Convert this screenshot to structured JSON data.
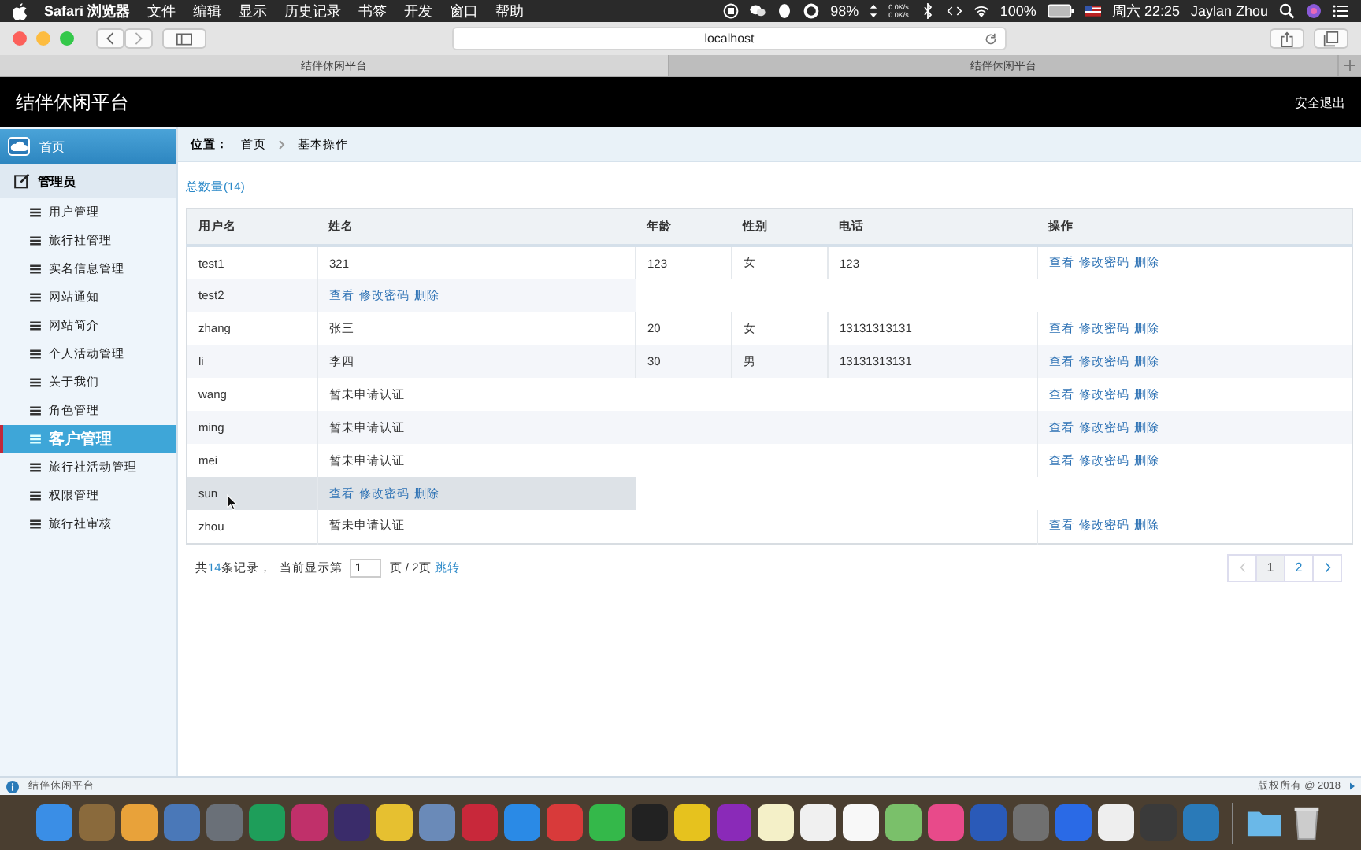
{
  "menubar": {
    "app": "Safari 浏览器",
    "menus": [
      "文件",
      "编辑",
      "显示",
      "历史记录",
      "书签",
      "开发",
      "窗口",
      "帮助"
    ],
    "cpu": "98%",
    "net_up": "0.0K/s",
    "net_down": "0.0K/s",
    "battery": "100%",
    "clock": "周六 22:25",
    "user": "Jaylan Zhou"
  },
  "browser": {
    "address": "localhost",
    "tabs": [
      {
        "title": "结伴休闲平台",
        "selected": true
      },
      {
        "title": "结伴休闲平台",
        "selected": false
      }
    ]
  },
  "header": {
    "title": "结伴休闲平台",
    "logout": "安全退出"
  },
  "sidebar": {
    "home": "首页",
    "section": "管理员",
    "items": [
      {
        "label": "用户管理",
        "selected": false
      },
      {
        "label": "旅行社管理",
        "selected": false
      },
      {
        "label": "实名信息管理",
        "selected": false
      },
      {
        "label": "网站通知",
        "selected": false
      },
      {
        "label": "网站简介",
        "selected": false
      },
      {
        "label": "个人活动管理",
        "selected": false
      },
      {
        "label": "关于我们",
        "selected": false
      },
      {
        "label": "角色管理",
        "selected": false
      },
      {
        "label": "客户管理",
        "selected": true
      },
      {
        "label": "旅行社活动管理",
        "selected": false
      },
      {
        "label": "权限管理",
        "selected": false
      },
      {
        "label": "旅行社审核",
        "selected": false
      }
    ]
  },
  "breadcrumb": {
    "label": "位置：",
    "items": [
      "首页",
      "基本操作"
    ]
  },
  "total": "总数量(14)",
  "table": {
    "columns": [
      "用户名",
      "姓名",
      "年龄",
      "性别",
      "电话",
      "操作"
    ],
    "rows": [
      {
        "kind": "full",
        "username": "test1",
        "name": "321",
        "age": "123",
        "gender": "女",
        "phone": "123",
        "actions": [
          "查看",
          "修改密码",
          "删除"
        ],
        "highlighted": false
      },
      {
        "kind": "short",
        "username": "test2",
        "actions": [
          "查看",
          "修改密码",
          "删除"
        ],
        "highlighted": false
      },
      {
        "kind": "full",
        "username": "zhang",
        "name": "张三",
        "age": "20",
        "gender": "女",
        "phone": "13131313131",
        "actions": [
          "查看",
          "修改密码",
          "删除"
        ],
        "highlighted": false
      },
      {
        "kind": "full",
        "username": "li",
        "name": "李四",
        "age": "30",
        "gender": "男",
        "phone": "13131313131",
        "actions": [
          "查看",
          "修改密码",
          "删除"
        ],
        "highlighted": false
      },
      {
        "kind": "pending",
        "username": "wang",
        "note": "暂未申请认证",
        "actions": [
          "查看",
          "修改密码",
          "删除"
        ],
        "highlighted": false
      },
      {
        "kind": "pending",
        "username": "ming",
        "note": "暂未申请认证",
        "actions": [
          "查看",
          "修改密码",
          "删除"
        ],
        "highlighted": false
      },
      {
        "kind": "pending",
        "username": "mei",
        "note": "暂未申请认证",
        "actions": [
          "查看",
          "修改密码",
          "删除"
        ],
        "highlighted": false
      },
      {
        "kind": "short",
        "username": "sun",
        "actions": [
          "查看",
          "修改密码",
          "删除"
        ],
        "highlighted": true
      },
      {
        "kind": "pending",
        "username": "zhou",
        "note": "暂未申请认证",
        "actions": [
          "查看",
          "修改密码",
          "删除"
        ],
        "highlighted": false
      }
    ]
  },
  "pager": {
    "before": "共",
    "count": "14",
    "after": "条记录，",
    "current_label": "当前显示第",
    "page_value": "1",
    "of": "页 / 2页",
    "jump": "跳转",
    "prev_disabled": true,
    "next_disabled": false,
    "pages": [
      {
        "label": "1",
        "selected": true
      },
      {
        "label": "2",
        "selected": false
      }
    ]
  },
  "status_bar": {
    "title": "结伴休闲平台",
    "copyright": "版权所有 @ 2018"
  }
}
